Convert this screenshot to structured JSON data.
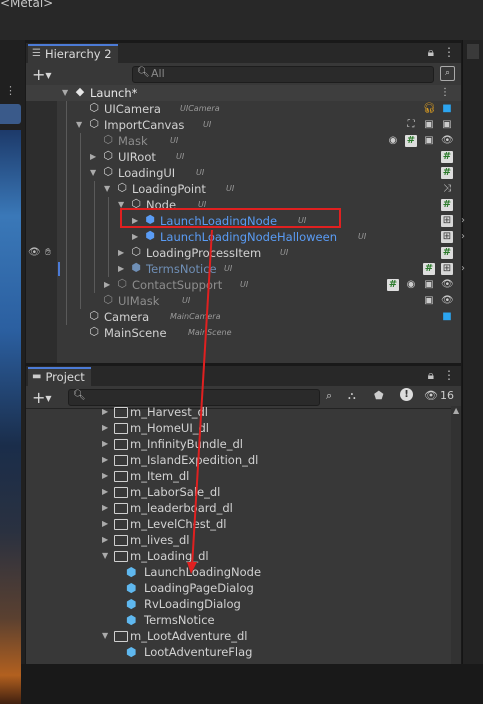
{
  "top_title": "<Metal>",
  "hierarchy": {
    "tab_label": "Hierarchy 2",
    "search_placeholder": "All",
    "add_label": "+",
    "rows": [
      {
        "label": "Launch*",
        "tag": ""
      },
      {
        "label": "UICamera",
        "tag": "UICamera"
      },
      {
        "label": "ImportCanvas",
        "tag": "UI"
      },
      {
        "label": "Mask",
        "tag": "UI"
      },
      {
        "label": "UIRoot",
        "tag": "UI"
      },
      {
        "label": "LoadingUI",
        "tag": "UI"
      },
      {
        "label": "LoadingPoint",
        "tag": "UI"
      },
      {
        "label": "Node",
        "tag": "UI"
      },
      {
        "label": "LaunchLoadingNode",
        "tag": "UI"
      },
      {
        "label": "LaunchLoadingNodeHalloween",
        "tag": "UI"
      },
      {
        "label": "LoadingProcessItem",
        "tag": "UI"
      },
      {
        "label": "TermsNotice",
        "tag": "UI"
      },
      {
        "label": "ContactSupport",
        "tag": "UI"
      },
      {
        "label": "UIMask",
        "tag": "UI"
      },
      {
        "label": "Camera",
        "tag": "MainCamera"
      },
      {
        "label": "MainScene",
        "tag": "MainScene"
      }
    ]
  },
  "project": {
    "tab_label": "Project",
    "hidden_count": "16",
    "items": [
      {
        "label": "m_Harvest_dl"
      },
      {
        "label": "m_HomeUI_dl"
      },
      {
        "label": "m_InfinityBundle_dl"
      },
      {
        "label": "m_IslandExpedition_dl"
      },
      {
        "label": "m_Item_dl"
      },
      {
        "label": "m_LaborSale_dl"
      },
      {
        "label": "m_leaderboard_dl"
      },
      {
        "label": "m_LevelChest_dl"
      },
      {
        "label": "m_lives_dl"
      },
      {
        "label": "m_Loading_dl"
      },
      {
        "label": "LaunchLoadingNode"
      },
      {
        "label": "LoadingPageDialog"
      },
      {
        "label": "RvLoadingDialog"
      },
      {
        "label": "TermsNotice"
      },
      {
        "label": "m_LootAdventure_dl"
      },
      {
        "label": "LootAdventureFlag"
      }
    ]
  },
  "colors": {
    "accent": "#4c7bd6",
    "highlight_box": "#e02020",
    "prefab_blue": "#5fb8ef"
  }
}
